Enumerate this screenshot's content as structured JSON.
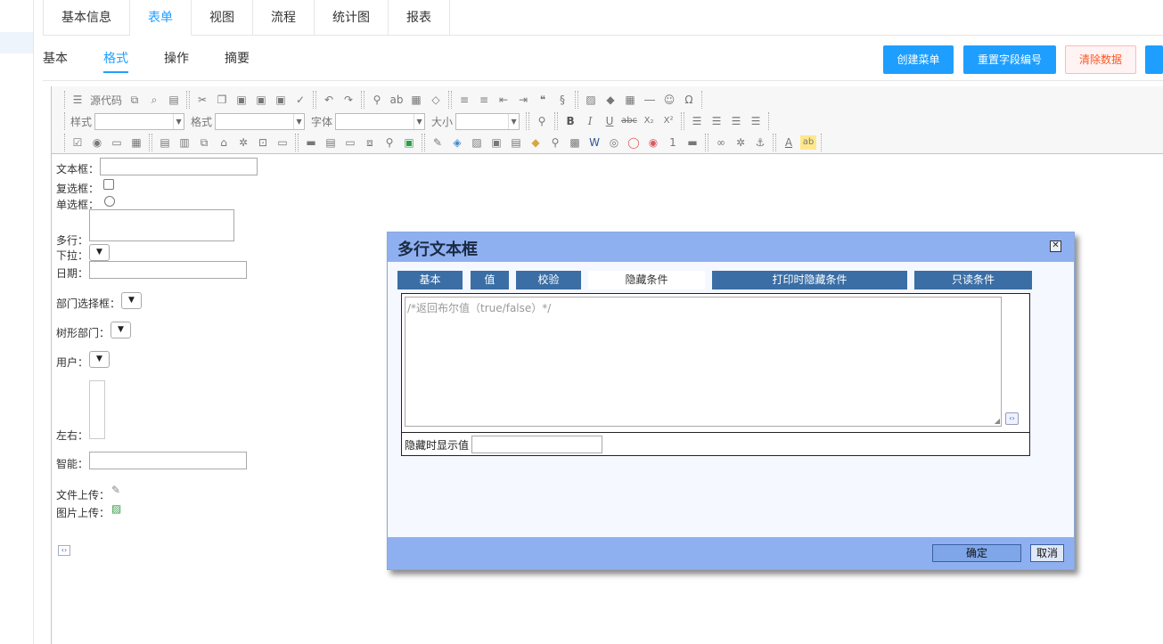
{
  "top_tabs": [
    "基本信息",
    "表单",
    "视图",
    "流程",
    "统计图",
    "报表"
  ],
  "sub_tabs": [
    "基本",
    "格式",
    "操作",
    "摘要"
  ],
  "actions": {
    "create_menu": "创建菜单",
    "reset_field_no": "重置字段编号",
    "clear_data": "清除数据"
  },
  "toolbar": {
    "source": "源代码",
    "style_label": "样式",
    "format_label": "格式",
    "font_label": "字体",
    "size_label": "大小",
    "bold": "B",
    "italic": "I",
    "underline": "U",
    "strike": "abc",
    "sub": "X₂",
    "sup": "X²",
    "font_color": "A",
    "bg_color": "ab"
  },
  "form": {
    "textbox": "文本框：",
    "checkbox": "复选框：",
    "radio": "单选框：",
    "multiline": "多行：",
    "dropdown": "下拉：",
    "date": "日期：",
    "dept": "部门选择框：",
    "tree_dept": "树形部门：",
    "user": "用户：",
    "leftright": "左右：",
    "smart": "智能：",
    "file_upload": "文件上传：",
    "image_upload": "图片上传："
  },
  "dialog": {
    "title": "多行文本框",
    "tabs": [
      "基本",
      "值",
      "校验",
      "隐藏条件",
      "打印时隐藏条件",
      "只读条件"
    ],
    "active_tab": "隐藏条件",
    "textarea_placeholder": "/*返回布尔值（true/false）*/",
    "hidden_display_label": "隐藏时显示值",
    "hidden_display_value": "",
    "ok": "确定",
    "cancel": "取消"
  },
  "colors": {
    "accent": "#1e9fff",
    "dialog_header": "#8fb0f0",
    "dialog_tab": "#3a6ea5"
  }
}
